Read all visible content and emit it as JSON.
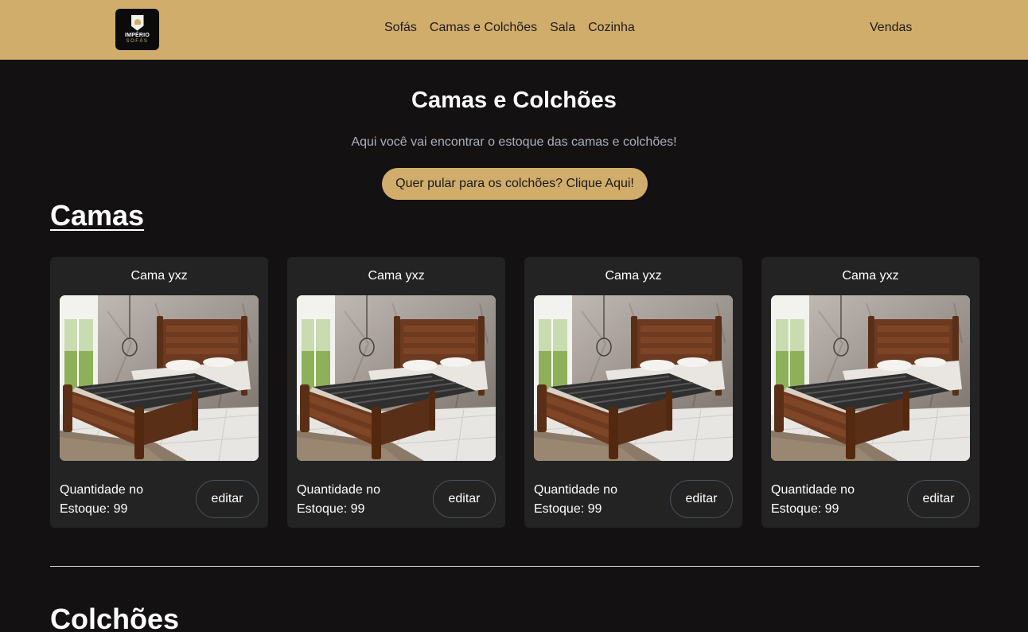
{
  "header": {
    "logo": {
      "line1": "IMPÉRIO",
      "line2": "SOFÁS"
    },
    "nav": [
      "Sofás",
      "Camas e Colchões",
      "Sala",
      "Cozinha"
    ],
    "sales_link": "Vendas"
  },
  "page": {
    "title": "Camas e Colchões",
    "subtitle": "Aqui você vai encontrar o estoque das camas e colchões!",
    "jump_button": "Quer pular para os colchões? Clique Aqui!"
  },
  "sections": {
    "beds": {
      "title": "Camas",
      "cards": [
        {
          "name": "Cama yxz",
          "stock_label": "Quantidade no Estoque: 99",
          "edit_label": "editar"
        },
        {
          "name": "Cama yxz",
          "stock_label": "Quantidade no Estoque: 99",
          "edit_label": "editar"
        },
        {
          "name": "Cama yxz",
          "stock_label": "Quantidade no Estoque: 99",
          "edit_label": "editar"
        },
        {
          "name": "Cama yxz",
          "stock_label": "Quantidade no Estoque: 99",
          "edit_label": "editar"
        }
      ]
    },
    "mattresses": {
      "title": "Colchões"
    }
  },
  "colors": {
    "header_bg": "#d1ad6b",
    "page_bg": "#141112",
    "card_bg": "#232323",
    "accent": "#d1ad6b"
  }
}
